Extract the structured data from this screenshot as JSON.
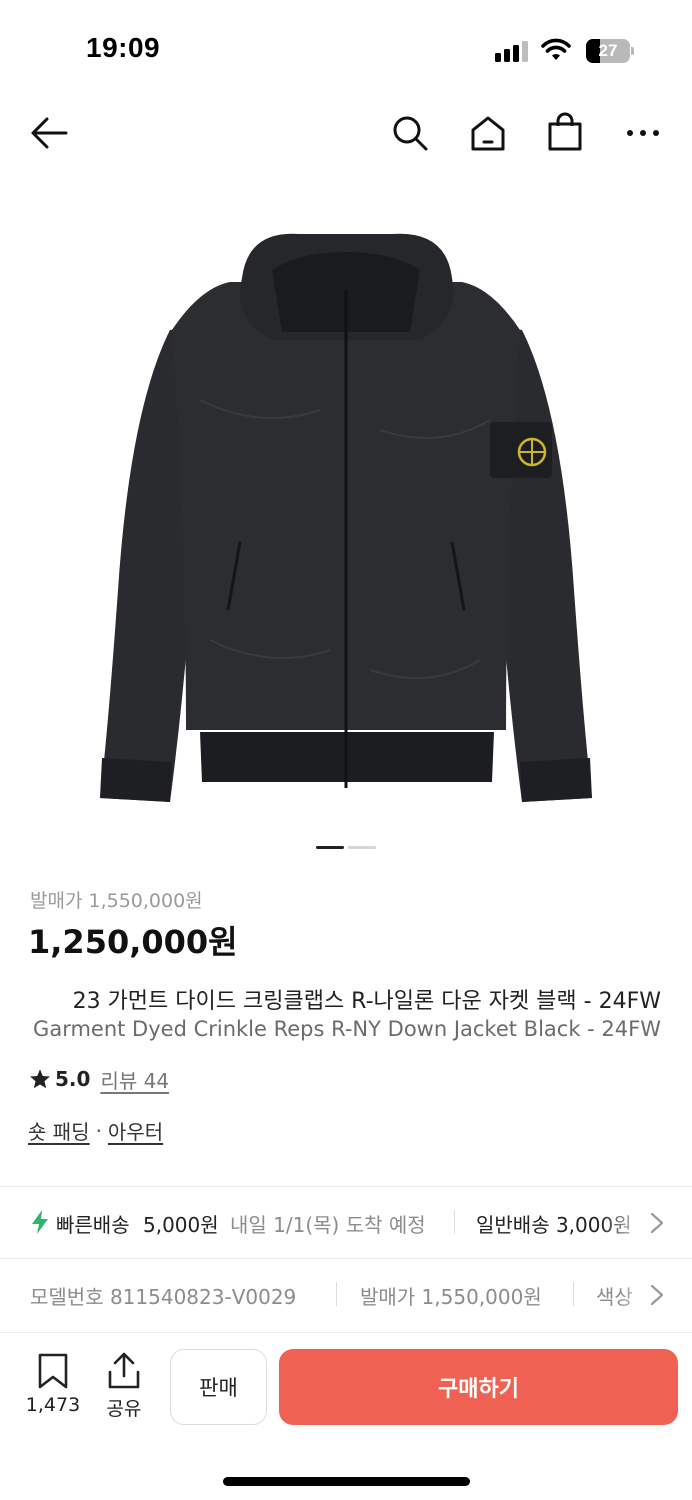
{
  "status_bar": {
    "time": "19:09",
    "battery": "27"
  },
  "nav": {
    "icons": [
      "back-arrow-icon",
      "search-icon",
      "home-icon",
      "shopping-bag-icon",
      "more-icon"
    ]
  },
  "product": {
    "image": "black-hooded-down-jacket",
    "image_count": 2,
    "active_image": 1,
    "release_price": "발매가 1,550,000원",
    "price": "1,250,000원",
    "title_ko": "23 가먼트 다이드 크링클랩스 R-나일론 다운 자켓 블랙 - 24FW",
    "title_en": "Garment Dyed Crinkle Reps R-NY Down Jacket Black - 24FW",
    "rating": "5.0",
    "review_label": "리뷰 44",
    "category_1": "숏 패딩",
    "category_separator": "·",
    "category_2": "아우터"
  },
  "delivery": {
    "fast_label": "빠른배송",
    "fast_price": "5,000원",
    "eta": "내일 1/1(목) 도착 예정",
    "standard": "일반배송 3,000원"
  },
  "specs": {
    "model": "모델번호 811540823-V0029",
    "release": "발매가 1,550,000원",
    "color": "색상"
  },
  "bottom_bar": {
    "wishlist_count": "1,473",
    "share_label": "공유",
    "sell_label": "판매",
    "buy_label": "구매하기"
  },
  "colors": {
    "buy_button": "#ef6253",
    "bolt": "#31b46e",
    "text_muted": "#8c8c8c"
  }
}
